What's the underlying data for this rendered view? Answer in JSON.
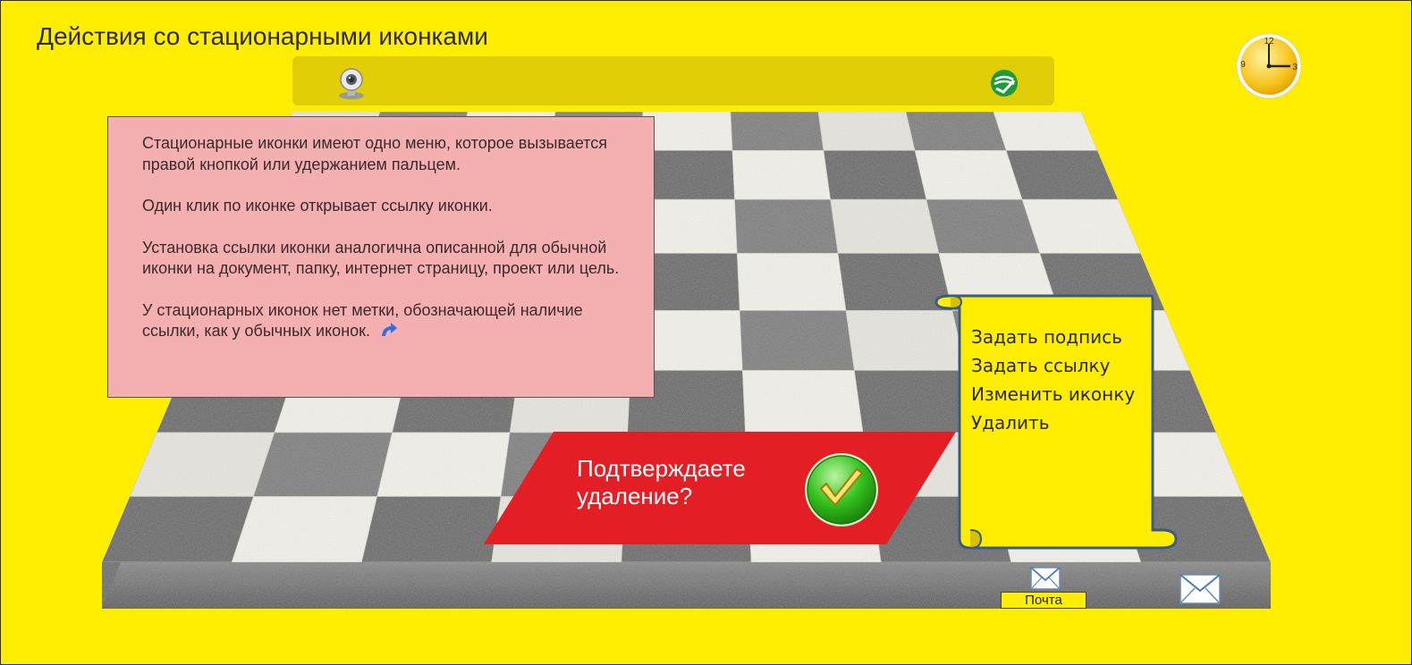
{
  "page": {
    "title": "Действия со стационарными иконками",
    "background_color": "#ffee00"
  },
  "toolbar": {
    "icons": [
      "webcam-icon",
      "sberbank-icon"
    ],
    "color": "#e1cd06"
  },
  "clock": {
    "numerals": [
      "12",
      "3",
      "9"
    ],
    "hour": 3,
    "minute": 0
  },
  "info": {
    "paragraphs": [
      "Стационарные иконки имеют одно меню, которое вызывается правой кнопкой или удержанием пальцем.",
      "Один клик  по иконке открывает ссылку иконки.",
      "Установка ссылки иконки аналогична описанной для обычной иконки на документ, папку, интернет страницу, проект или цель.",
      "У стационарных иконок нет метки, обозначающей наличие ссылки, как у обычных иконок."
    ],
    "link_mark_icon": "link-arrow-icon",
    "background_color": "#f4b0b0"
  },
  "context_menu": {
    "items": [
      "Задать подпись",
      "Задать ссылку",
      "Изменить иконку",
      "Удалить"
    ],
    "scroll_color": "#ffee00",
    "border_color": "#3a5a8a"
  },
  "confirm": {
    "text": "Подтверждаете удаление?",
    "button_icon": "green-check-icon",
    "background_color": "#e31e24"
  },
  "mail": {
    "label": "Почта",
    "icons": [
      "envelope-icon",
      "envelope-icon"
    ]
  }
}
